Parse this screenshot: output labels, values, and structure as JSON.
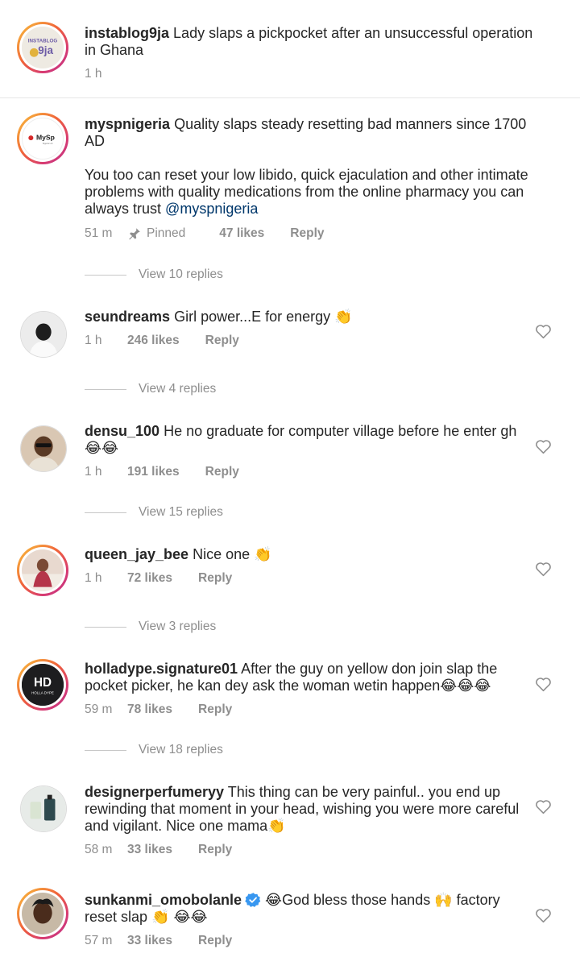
{
  "caption": {
    "username": "instablog9ja",
    "text": "Lady slaps a pickpocket after an unsuccessful operation in Ghana",
    "time": "1 h",
    "avatar_text": "INSTABLOG 9ja"
  },
  "pinned_comment": {
    "username": "myspnigeria",
    "text": "Quality slaps steady resetting bad manners since 1700 AD",
    "text2": "You too can reset your low libido, quick ejaculation and other intimate problems with quality medications from the online pharmacy you can always trust",
    "mention": "@myspnigeria",
    "time": "51 m",
    "pinned_label": "Pinned",
    "likes": "47 likes",
    "reply_label": "Reply",
    "view_replies": "View 10 replies",
    "avatar_text": "MySp"
  },
  "comments": [
    {
      "username": "seundreams",
      "text": "Girl power...E for energy 👏",
      "time": "1 h",
      "likes": "246 likes",
      "reply_label": "Reply",
      "view_replies": "View 4 replies"
    },
    {
      "username": "densu_100",
      "text": "He no graduate for computer village before he enter gh 😂😂",
      "time": "1 h",
      "likes": "191 likes",
      "reply_label": "Reply",
      "view_replies": "View 15 replies"
    },
    {
      "username": "queen_jay_bee",
      "text": "Nice one 👏",
      "time": "1 h",
      "likes": "72 likes",
      "reply_label": "Reply",
      "view_replies": "View 3 replies"
    },
    {
      "username": "holladype.signature01",
      "text": "After the guy on yellow don join slap the pocket picker, he kan dey ask the woman wetin happen😂😂😂",
      "time": "59 m",
      "likes": "78 likes",
      "reply_label": "Reply",
      "view_replies": "View 18 replies",
      "avatar_text": "HOLLA DYPE"
    },
    {
      "username": "designerperfumeryy",
      "text": "This thing can be very painful.. you end up rewinding that moment in your head, wishing you were more careful and vigilant. Nice one mama👏",
      "time": "58 m",
      "likes": "33 likes",
      "reply_label": "Reply"
    },
    {
      "username": "sunkanmi_omobolanle",
      "text": "😂God bless those hands 🙌 factory reset slap 👏 😂😂",
      "time": "57 m",
      "likes": "33 likes",
      "reply_label": "Reply"
    }
  ],
  "colors": {
    "text": "#262626",
    "muted": "#8e8e8e",
    "mention": "#00376b",
    "verified": "#3897f0",
    "ring_start": "#f9c53c",
    "ring_end": "#c13584"
  }
}
